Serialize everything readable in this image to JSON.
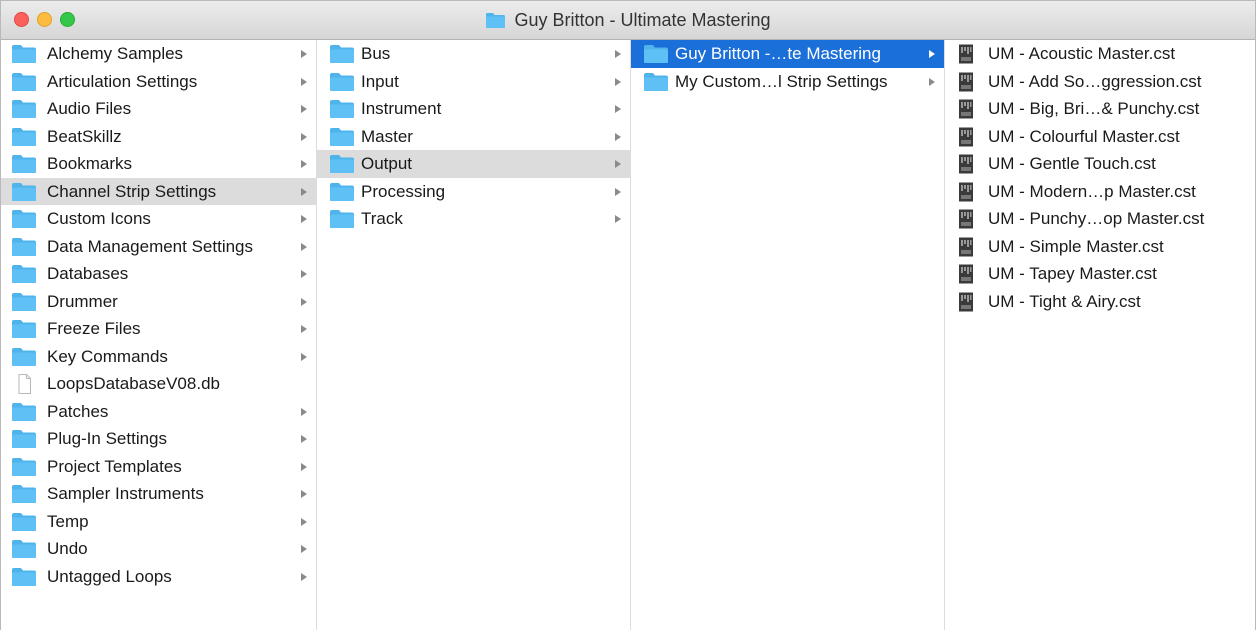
{
  "window": {
    "title": "Guy Britton - Ultimate Mastering",
    "title_icon": "folder-icon"
  },
  "colors": {
    "folder": "#5ec0f5",
    "folder_tab": "#4fb3ec",
    "selection_blue": "#1a6fd8",
    "selection_gray": "#dcdcdc"
  },
  "columns": [
    {
      "items": [
        {
          "label": "Alchemy Samples",
          "icon": "folder-icon",
          "arrow": true
        },
        {
          "label": "Articulation Settings",
          "icon": "folder-icon",
          "arrow": true
        },
        {
          "label": "Audio Files",
          "icon": "folder-icon",
          "arrow": true
        },
        {
          "label": "BeatSkillz",
          "icon": "folder-icon",
          "arrow": true
        },
        {
          "label": "Bookmarks",
          "icon": "folder-icon",
          "arrow": true
        },
        {
          "label": "Channel Strip Settings",
          "icon": "folder-icon",
          "arrow": true,
          "selected": "gray"
        },
        {
          "label": "Custom Icons",
          "icon": "folder-icon",
          "arrow": true
        },
        {
          "label": "Data Management Settings",
          "icon": "folder-icon",
          "arrow": true
        },
        {
          "label": "Databases",
          "icon": "folder-icon",
          "arrow": true
        },
        {
          "label": "Drummer",
          "icon": "folder-icon",
          "arrow": true
        },
        {
          "label": "Freeze Files",
          "icon": "folder-icon",
          "arrow": true
        },
        {
          "label": "Key Commands",
          "icon": "folder-icon",
          "arrow": true
        },
        {
          "label": "LoopsDatabaseV08.db",
          "icon": "document-icon",
          "arrow": false
        },
        {
          "label": "Patches",
          "icon": "folder-icon",
          "arrow": true
        },
        {
          "label": "Plug-In Settings",
          "icon": "folder-icon",
          "arrow": true
        },
        {
          "label": "Project Templates",
          "icon": "folder-icon",
          "arrow": true
        },
        {
          "label": "Sampler Instruments",
          "icon": "folder-icon",
          "arrow": true
        },
        {
          "label": "Temp",
          "icon": "folder-icon",
          "arrow": true
        },
        {
          "label": "Undo",
          "icon": "folder-icon",
          "arrow": true
        },
        {
          "label": "Untagged Loops",
          "icon": "folder-icon",
          "arrow": true
        }
      ]
    },
    {
      "items": [
        {
          "label": "Bus",
          "icon": "folder-icon",
          "arrow": true
        },
        {
          "label": "Input",
          "icon": "folder-icon",
          "arrow": true
        },
        {
          "label": "Instrument",
          "icon": "folder-icon",
          "arrow": true
        },
        {
          "label": "Master",
          "icon": "folder-icon",
          "arrow": true
        },
        {
          "label": "Output",
          "icon": "folder-icon",
          "arrow": true,
          "selected": "gray"
        },
        {
          "label": "Processing",
          "icon": "folder-icon",
          "arrow": true
        },
        {
          "label": "Track",
          "icon": "folder-icon",
          "arrow": true
        }
      ]
    },
    {
      "items": [
        {
          "label": "Guy Britton -…te Mastering",
          "icon": "folder-icon",
          "arrow": true,
          "selected": "blue"
        },
        {
          "label": "My Custom…l Strip Settings",
          "icon": "folder-icon",
          "arrow": true
        }
      ]
    },
    {
      "items": [
        {
          "label": "UM - Acoustic Master.cst",
          "icon": "channel-strip-file-icon",
          "arrow": false
        },
        {
          "label": "UM - Add So…ggression.cst",
          "icon": "channel-strip-file-icon",
          "arrow": false
        },
        {
          "label": "UM - Big, Bri…& Punchy.cst",
          "icon": "channel-strip-file-icon",
          "arrow": false
        },
        {
          "label": "UM - Colourful Master.cst",
          "icon": "channel-strip-file-icon",
          "arrow": false
        },
        {
          "label": "UM - Gentle Touch.cst",
          "icon": "channel-strip-file-icon",
          "arrow": false
        },
        {
          "label": "UM - Modern…p Master.cst",
          "icon": "channel-strip-file-icon",
          "arrow": false
        },
        {
          "label": "UM - Punchy…op Master.cst",
          "icon": "channel-strip-file-icon",
          "arrow": false
        },
        {
          "label": "UM - Simple Master.cst",
          "icon": "channel-strip-file-icon",
          "arrow": false
        },
        {
          "label": "UM - Tapey Master.cst",
          "icon": "channel-strip-file-icon",
          "arrow": false
        },
        {
          "label": "UM - Tight & Airy.cst",
          "icon": "channel-strip-file-icon",
          "arrow": false
        }
      ]
    }
  ]
}
